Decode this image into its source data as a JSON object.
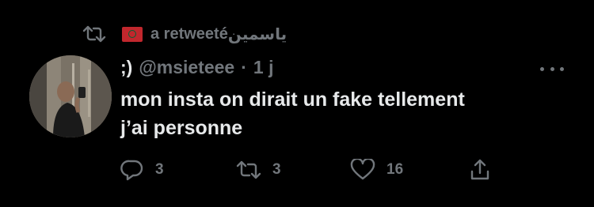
{
  "retweet_context": {
    "text": "a retweeté",
    "name": "ياسمين"
  },
  "author": {
    "display_name": ";)",
    "handle": "@msieteee",
    "separator": "·",
    "time": "1 j"
  },
  "tweet": {
    "lines": [
      "mon insta on dirait un fake tellement",
      "j’ai personne"
    ]
  },
  "actions": {
    "replies": "3",
    "retweets": "3",
    "likes": "16"
  },
  "icons": {
    "retweet_context": "retweet-icon",
    "flag": "morocco-flag-icon",
    "reply": "reply-icon",
    "retweet": "retweet-icon",
    "like": "heart-icon",
    "share": "share-icon",
    "more": "more-icon"
  },
  "colors": {
    "background": "#000000",
    "text_primary": "#e7e9ea",
    "text_secondary": "#71767b"
  }
}
